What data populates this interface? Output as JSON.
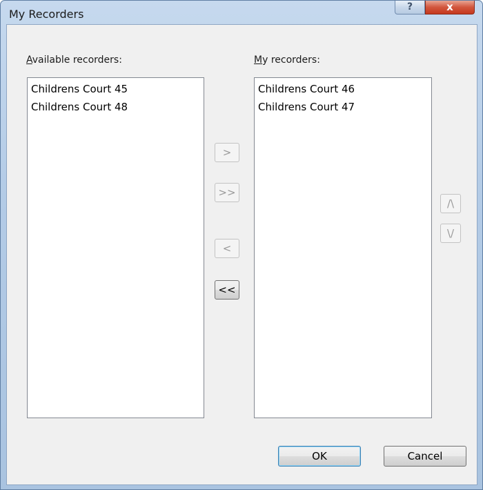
{
  "window": {
    "title": "My Recorders",
    "help_label": "?",
    "close_label": "x"
  },
  "available": {
    "label": "Available recorders:",
    "items": [
      "Childrens Court 45",
      "Childrens Court 48"
    ]
  },
  "mine": {
    "label": "My recorders:",
    "items": [
      "Childrens Court 46",
      "Childrens Court 47"
    ]
  },
  "transfer": {
    "add": ">",
    "add_all": ">>",
    "remove": "<",
    "remove_all": "<<"
  },
  "order": {
    "up": "/\\",
    "down": "\\/"
  },
  "dialog": {
    "ok": "OK",
    "cancel": "Cancel"
  }
}
